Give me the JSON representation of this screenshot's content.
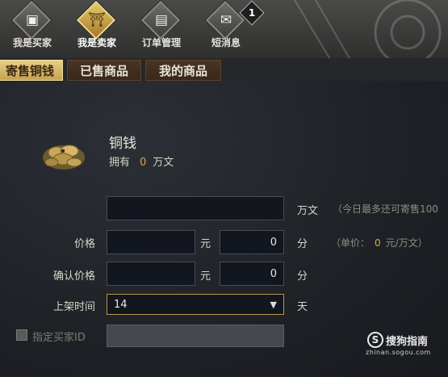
{
  "nav": {
    "items": [
      {
        "label": "我是买家",
        "glyph": "▣"
      },
      {
        "label": "我是卖家",
        "glyph": "⛩"
      },
      {
        "label": "订单管理",
        "glyph": "▤"
      },
      {
        "label": "短消息",
        "glyph": "✉"
      }
    ],
    "message_badge": "1"
  },
  "tabs": [
    {
      "label": "寄售铜钱"
    },
    {
      "label": "已售商品"
    },
    {
      "label": "我的商品"
    }
  ],
  "item": {
    "name": "铜钱",
    "own_prefix": "拥有",
    "own_value": "0",
    "own_unit": "万文"
  },
  "form": {
    "amount_unit": "万文",
    "amount_hint": "（今日最多还可寄售100",
    "price_label": "价格",
    "confirm_price_label": "确认价格",
    "yuan": "元",
    "fen": "分",
    "price_fen_value": "0",
    "confirm_fen_value": "0",
    "unit_price_prefix": "（单价：",
    "unit_price_value": "0",
    "unit_price_suffix": "元/万文）",
    "duration_label": "上架时间",
    "duration_value": "14",
    "duration_unit": "天",
    "buyer_id_label": "指定买家ID"
  },
  "watermark": {
    "icon": "S",
    "main": "搜狗指南",
    "sub": "zhinan.sogou.com"
  },
  "colors": {
    "accent_gold": "#d8a84a",
    "active_tab": "#e9cf86"
  }
}
